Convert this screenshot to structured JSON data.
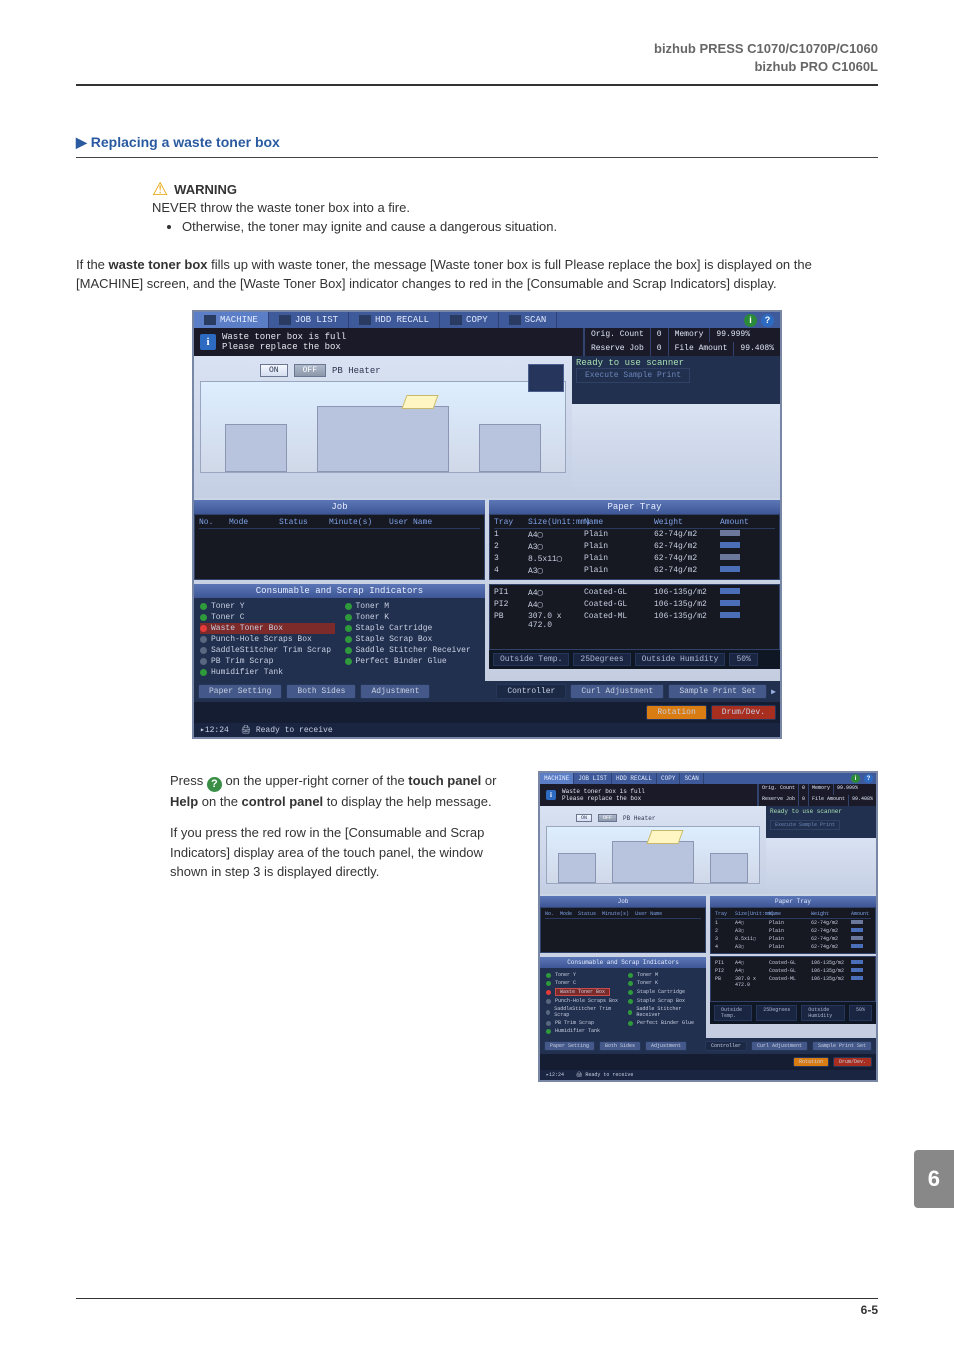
{
  "header": {
    "line1": "bizhub PRESS C1070/C1070P/C1060",
    "line2": "bizhub PRO C1060L"
  },
  "section_title": "Replacing a waste toner box",
  "warning": {
    "label": "WARNING",
    "line1": "NEVER throw the waste toner box into a fire.",
    "bullet1": "Otherwise, the toner may ignite and cause a dangerous situation."
  },
  "body_para": "If the <b>waste toner box</b> fills up with waste toner, the message [Waste toner box is full Please replace the box] is displayed on the [MACHINE] screen, and the [Waste Toner Box] indicator changes to red in the [Consumable and Scrap Indicators] display.",
  "screen": {
    "tabs": {
      "machine": "MACHINE",
      "joblist": "JOB LIST",
      "hddrecall": "HDD RECALL",
      "copy": "COPY",
      "scan": "SCAN"
    },
    "message_l1": "Waste toner box is full",
    "message_l2": "Please replace the box",
    "meta": {
      "orig_count_label": "Orig. Count",
      "orig_count_val": "0",
      "memory_label": "Memory",
      "memory_val": "99.999%",
      "reserve_label": "Reserve Job",
      "reserve_val": "0",
      "file_label": "File Amount",
      "file_val": "99.408%",
      "ready_scanner": "Ready to use scanner",
      "exec_sample": "Execute Sample Print"
    },
    "heater": {
      "on": "ON",
      "off": "OFF",
      "label": "PB Heater"
    },
    "job": {
      "header": "Job",
      "cols": [
        "No.",
        "Mode",
        "Status",
        "Minute(s)",
        "User Name"
      ]
    },
    "paper": {
      "header": "Paper Tray",
      "cols": {
        "tray": "Tray",
        "size": "Size(Unit:mm)",
        "name": "Name",
        "weight": "Weight",
        "amount": "Amount"
      },
      "rows": [
        {
          "tray": "1",
          "size": "A4▢",
          "name": "Plain",
          "weight": "62-74g/m2",
          "amt": "low"
        },
        {
          "tray": "2",
          "size": "A3▢",
          "name": "Plain",
          "weight": "62-74g/m2",
          "amt": "bar"
        },
        {
          "tray": "3",
          "size": "8.5x11▢",
          "name": "Plain",
          "weight": "62-74g/m2",
          "amt": "low"
        },
        {
          "tray": "4",
          "size": "A3▢",
          "name": "Plain",
          "weight": "62-74g/m2",
          "amt": "bar"
        }
      ],
      "pi_rows": [
        {
          "tray": "PI1",
          "size": "A4▢",
          "name": "Coated-GL",
          "weight": "106-135g/m2",
          "amt": "bar"
        },
        {
          "tray": "PI2",
          "size": "A4▢",
          "name": "Coated-GL",
          "weight": "106-135g/m2",
          "amt": "bar"
        },
        {
          "tray": "PB",
          "size": "307.0 x 472.0",
          "name": "Coated-ML",
          "weight": "106-135g/m2",
          "amt": "bar"
        }
      ]
    },
    "consumables": {
      "header": "Consumable and Scrap Indicators",
      "left": [
        {
          "led": "ok",
          "label": "Toner Y"
        },
        {
          "led": "ok",
          "label": "Toner C"
        },
        {
          "led": "red",
          "label": "Waste Toner Box"
        },
        {
          "led": "gray",
          "label": "Punch-Hole Scraps Box"
        },
        {
          "led": "gray",
          "label": "SaddleStitcher Trim Scrap"
        },
        {
          "led": "gray",
          "label": "PB Trim Scrap"
        }
      ],
      "right": [
        {
          "led": "ok",
          "label": "Toner M"
        },
        {
          "led": "ok",
          "label": "Toner K"
        },
        {
          "led": "ok",
          "label": "Staple Cartridge"
        },
        {
          "led": "ok",
          "label": "Staple Scrap Box"
        },
        {
          "led": "ok",
          "label": "Saddle Stitcher Receiver"
        },
        {
          "led": "ok",
          "label": "Perfect Binder Glue"
        },
        {
          "led": "ok",
          "label": "Humidifier Tank"
        }
      ]
    },
    "env": {
      "temp_label": "Outside Temp.",
      "temp_val": "25Degrees",
      "humid_label": "Outside Humidity",
      "humid_val": "50%"
    },
    "ctrl": {
      "paper_setting": "Paper Setting",
      "both_sides": "Both Sides",
      "adjustment": "Adjustment",
      "controller": "Controller",
      "curl_adj": "Curl Adjustment",
      "sample_print": "Sample Print Set",
      "rotation": "Rotation",
      "drumdev": "Drum/Dev."
    },
    "status_time": "12:24",
    "status_text": "Ready to receive"
  },
  "instruction": {
    "para1_pre": "Press ",
    "para1_post": " on the upper-right corner of the ",
    "touch_panel": "touch panel",
    "or": " or ",
    "help": "Help",
    "on_the": " on the ",
    "control_panel": "control panel",
    "to_display": " to display the help message.",
    "para2": "If you press the red row in the [Consumable and Scrap Indicators] display area of the touch panel, the window shown in step 3 is displayed directly."
  },
  "chapter_num": "6",
  "page_num": "6-5"
}
